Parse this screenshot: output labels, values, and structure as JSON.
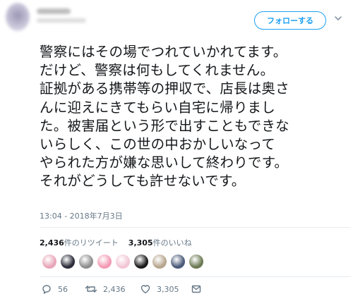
{
  "header": {
    "follow_label": "フォローする",
    "menu_icon": "chevron-down-icon"
  },
  "tweet": {
    "text": "警察にはその場でつれていかれてます。\nだけど、警察は何もしてくれません。\n証拠がある携帯等の押収で、店長は奥さ\nんに迎えにきてもらい自宅に帰りまし\nた。被害届という形で出すこともできな\nいらしく、この世の中おかしいなって\nやられた方が嫌な思いして終わりです。\nそれがどうしても許せないです。",
    "timestamp": "13:04 - 2018年7月3日"
  },
  "stats": {
    "retweet_count": "2,436",
    "retweet_label": "件のリツイート",
    "like_count": "3,305",
    "like_label": "件のいいね"
  },
  "likers": [
    {
      "name": "liker-avatar-1",
      "color": "#e8a5b8"
    },
    {
      "name": "liker-avatar-2",
      "color": "#2b2b3a"
    },
    {
      "name": "liker-avatar-3",
      "color": "#8e8e8e"
    },
    {
      "name": "liker-avatar-4",
      "color": "#f39ab4"
    },
    {
      "name": "liker-avatar-5",
      "color": "#f2c6d4"
    },
    {
      "name": "liker-avatar-6",
      "color": "#1a1a1a"
    },
    {
      "name": "liker-avatar-7",
      "color": "#b7a58e"
    },
    {
      "name": "liker-avatar-8",
      "color": "#4a5a78"
    },
    {
      "name": "liker-avatar-9",
      "color": "#6b7a52"
    }
  ],
  "actions": {
    "reply_count": "56",
    "retweet_count": "2,436",
    "like_count": "3,305"
  },
  "colors": {
    "accent": "#1da1f2",
    "secondary_text": "#657786",
    "divider": "#e6ecf0"
  }
}
